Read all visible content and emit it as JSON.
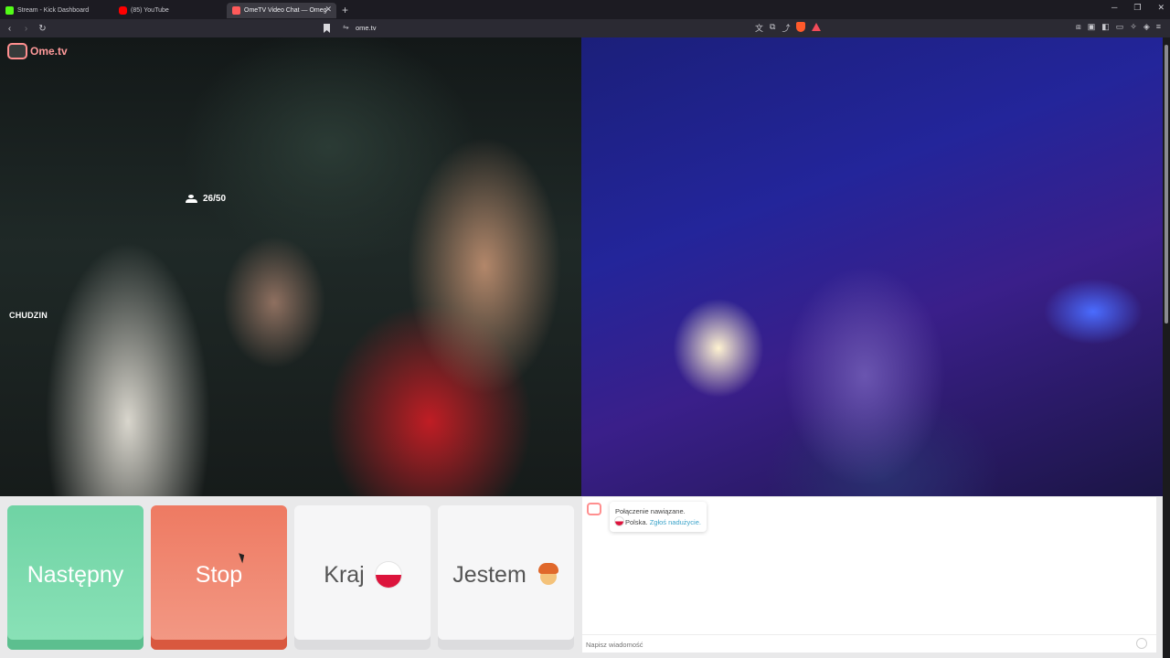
{
  "browser": {
    "tabs": [
      {
        "label": "Stream - Kick Dashboard",
        "favicon_color": "#53fc18"
      },
      {
        "label": "(85) YouTube",
        "favicon_color": "#ff0000"
      },
      {
        "label": "OmeTV Video Chat — Omeg",
        "favicon_color": "#ff5a5a",
        "active": true
      }
    ],
    "new_tab": "+",
    "url": "ome.tv"
  },
  "video": {
    "logo_text": "Ome.tv",
    "online_count": "26/50",
    "streamer_name": "CHUDZIN"
  },
  "controls": {
    "next_label": "Następny",
    "stop_label": "Stop",
    "country_label": "Kraj",
    "gender_label": "Jestem"
  },
  "chat": {
    "status": "Połączenie nawiązane.",
    "country": "Polska.",
    "report_link": "Zgłoś nadużycie.",
    "input_placeholder": "Napisz wiadomość"
  },
  "colors": {
    "next": "#7fdcae",
    "stop": "#f08870",
    "accent_link": "#3aa3c9"
  }
}
